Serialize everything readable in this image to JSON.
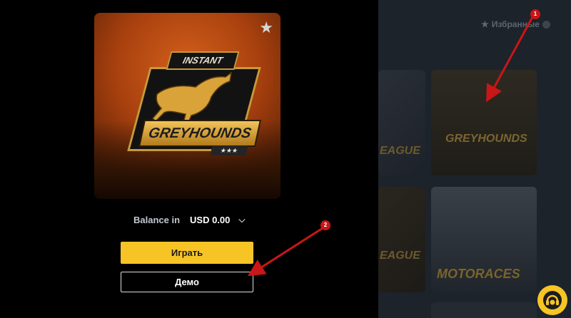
{
  "game": {
    "title_top": "INSTANT",
    "title_main": "GREYHOUNDS",
    "stars": "★★★"
  },
  "balance": {
    "label": "Balance in",
    "amount": "USD 0.00"
  },
  "buttons": {
    "play": "Играть",
    "demo": "Демо"
  },
  "background": {
    "favorites_label": "Избранные",
    "tiles": [
      {
        "text": "EAGUE"
      },
      {
        "text": "GREYHOUNDS"
      },
      {
        "text": "EAGUE"
      },
      {
        "text": "MOTORACES"
      }
    ]
  },
  "annotations": {
    "marker_1": "1",
    "marker_2": "2"
  },
  "colors": {
    "play_button": "#f7c426",
    "annotation_arrow": "#c91616",
    "overlay_panel": "#000000"
  }
}
